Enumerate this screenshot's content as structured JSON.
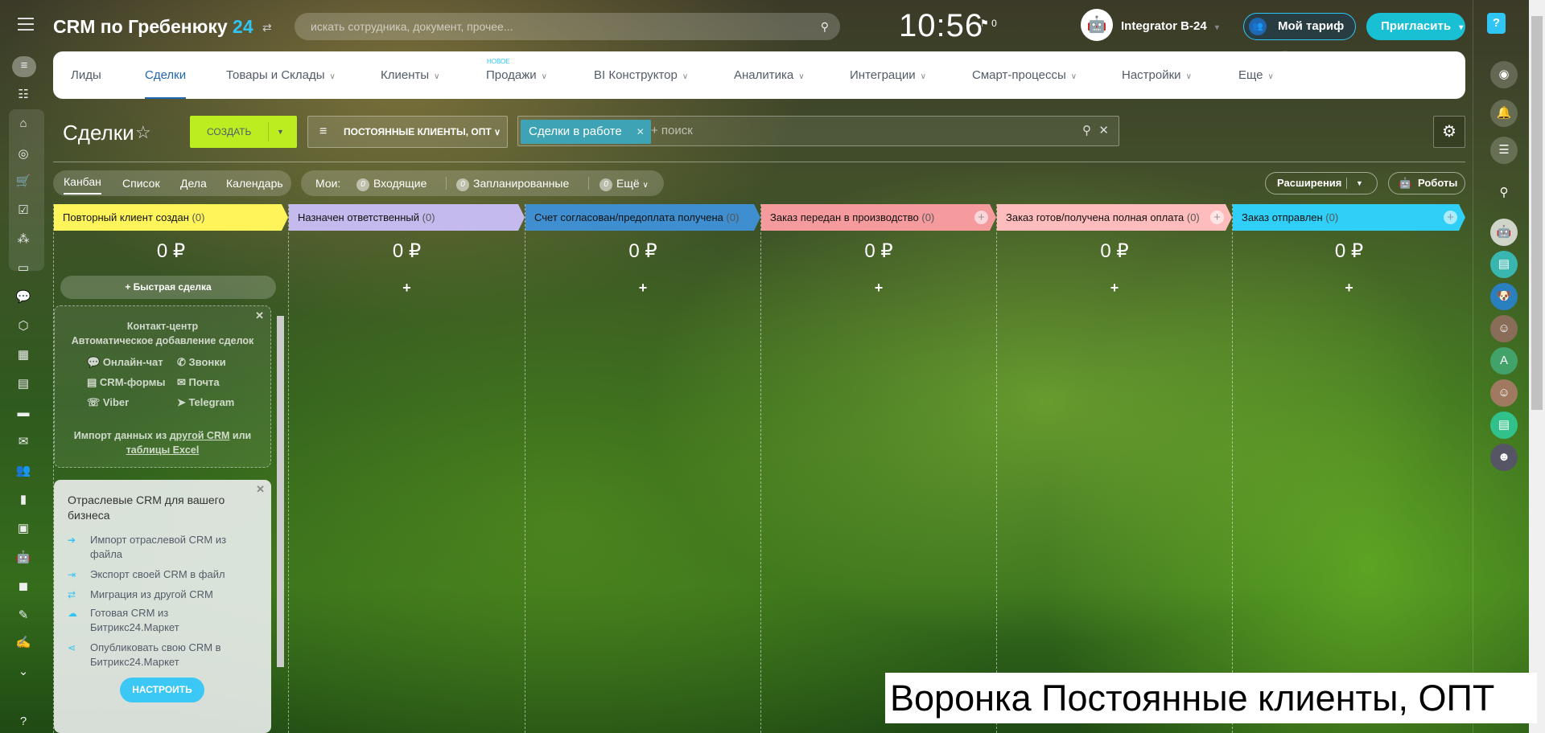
{
  "header": {
    "logo_text": "CRM по Гребенюку",
    "logo_num": "24",
    "search_placeholder": "искать сотрудника, документ, прочее...",
    "clock": "10:56",
    "flag_count": "0",
    "user_name": "Integrator B-24",
    "tariff_label": "Мой тариф",
    "invite_label": "Пригласить",
    "help": "?"
  },
  "nav": {
    "items": [
      {
        "label": "Лиды"
      },
      {
        "label": "Сделки",
        "active": true
      },
      {
        "label": "Товары и Склады"
      },
      {
        "label": "Клиенты"
      },
      {
        "label": "Продажи",
        "badge": "НОВОЕ"
      },
      {
        "label": "BI Конструктор"
      },
      {
        "label": "Аналитика"
      },
      {
        "label": "Интеграции"
      },
      {
        "label": "Смарт-процессы"
      },
      {
        "label": "Настройки"
      },
      {
        "label": "Еще"
      }
    ]
  },
  "toolbar": {
    "title": "Сделки",
    "create_label": "СОЗДАТЬ",
    "filter_label": "ПОСТОЯННЫЕ КЛИЕНТЫ, ОПТ",
    "chip_label": "Сделки в работе",
    "search_placeholder": "+ поиск"
  },
  "views": {
    "tabs": [
      "Канбан",
      "Список",
      "Дела",
      "Календарь"
    ],
    "active": "Канбан",
    "mine_label": "Мои:",
    "counters": [
      {
        "count": "0",
        "label": "Входящие"
      },
      {
        "count": "0",
        "label": "Запланированные"
      },
      {
        "count": "0",
        "label": "Ещё"
      }
    ],
    "extensions_label": "Расширения",
    "robots_label": "Роботы"
  },
  "columns": [
    {
      "title": "Повторный клиент создан",
      "count": "(0)",
      "sum": "0 ₽",
      "color": "#fff55a"
    },
    {
      "title": "Назначен ответственный",
      "count": "(0)",
      "sum": "0 ₽",
      "color": "#c4baed"
    },
    {
      "title": "Счет согласован/предоплата получена",
      "count": "(0)",
      "sum": "0 ₽",
      "color": "#3e8ed0"
    },
    {
      "title": "Заказ передан в производство",
      "count": "(0)",
      "sum": "0 ₽",
      "color": "#f59a9d"
    },
    {
      "title": "Заказ готов/получена полная оплата",
      "count": "(0)",
      "sum": "0 ₽",
      "color": "#ffbcbd"
    },
    {
      "title": "Заказ отправлен",
      "count": "(0)",
      "sum": "0 ₽",
      "color": "#2fcff7"
    }
  ],
  "quick_deal": "Быстрая сделка",
  "contact_center": {
    "title": "Контакт-центр",
    "subtitle": "Автоматическое добавление сделок",
    "channels": [
      "Онлайн-чат",
      "Звонки",
      "CRM-формы",
      "Почта",
      "Viber",
      "Telegram"
    ],
    "import_pre": "Импорт данных из ",
    "import_link1": "другой CRM",
    "import_mid": " или",
    "import_link2": "таблицы Excel"
  },
  "industry_crm": {
    "title": "Отраслевые CRM для вашего бизнеса",
    "items": [
      "Импорт отраслевой CRM из файла",
      "Экспорт своей CRM в файл",
      "Миграция из другой CRM",
      "Готовая CRM из Битрикс24.Маркет",
      "Опубликовать свою CRM в Битрикс24.Маркет"
    ],
    "button": "НАСТРОИТЬ"
  },
  "caption": "Воронка Постоянные клиенты, ОПТ"
}
